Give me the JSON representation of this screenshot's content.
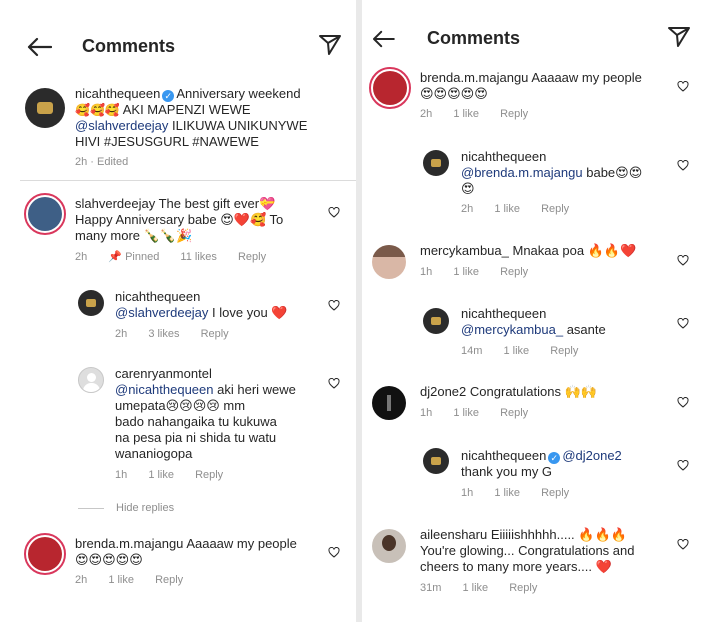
{
  "left": {
    "header": {
      "title": "Comments"
    },
    "caption": {
      "user": "nicahthequeen",
      "text_1": "Anniversary weekend",
      "text_2": "AKI MAPENZI WEWE",
      "mention": "@slahverdeejay",
      "text_3": "ILIKUWA UNIKUNYWE",
      "text_4": "HIVI #JESUSGURL #NAWEWE",
      "emoji_1": "🥰🥰🥰",
      "meta": "2h · Edited"
    },
    "comments": [
      {
        "user": "slahverdeejay",
        "text_1": "The best gift ever💝",
        "text_2": "Happy Anniversary babe 😍❤️🥰 To",
        "text_3": "many more 🍾🍾🎉",
        "time": "2h",
        "pinned": "Pinned",
        "likes": "11 likes",
        "reply": "Reply"
      },
      {
        "user": "nicahthequeen",
        "mention": "@slahverdeejay",
        "text_1": "I love you ❤️",
        "time": "2h",
        "likes": "3 likes",
        "reply": "Reply"
      },
      {
        "user": "carenryanmontel",
        "mention": "@nicahthequeen",
        "text_1": "aki heri wewe",
        "text_2": "umepata😢😢😢😢 mm",
        "text_3": "bado nahangaika tu kukuwa",
        "text_4": "na pesa pia ni shida tu watu",
        "text_5": "wananiogopa",
        "time": "1h",
        "likes": "1 like",
        "reply": "Reply"
      },
      {
        "user": "brenda.m.majangu",
        "text_1": "Aaaaaw my people",
        "text_2": "😍😍😍😍😍",
        "time": "2h",
        "likes": "1 like",
        "reply": "Reply"
      }
    ],
    "hide_replies": "Hide replies"
  },
  "right": {
    "header": {
      "title": "Comments"
    },
    "comments": [
      {
        "user": "brenda.m.majangu",
        "text_1": "Aaaaaw my people",
        "text_2": "😍😍😍😍😍",
        "time": "2h",
        "likes": "1 like",
        "reply": "Reply"
      },
      {
        "user": "nicahthequeen",
        "mention": "@brenda.m.majangu",
        "text_1": "babe😍😍",
        "text_2": "😍",
        "time": "2h",
        "likes": "1 like",
        "reply": "Reply"
      },
      {
        "user": "mercykambua_",
        "text_1": "Mnakaa poa 🔥🔥❤️",
        "time": "1h",
        "likes": "1 like",
        "reply": "Reply"
      },
      {
        "user": "nicahthequeen",
        "mention": "@mercykambua_",
        "text_1": "asante",
        "time": "14m",
        "likes": "1 like",
        "reply": "Reply"
      },
      {
        "user": "dj2one2",
        "text_1": "Congratulations 🙌🙌",
        "time": "1h",
        "likes": "1 like",
        "reply": "Reply"
      },
      {
        "user": "nicahthequeen",
        "mention": "@dj2one2",
        "text_1": "thank you my G",
        "time": "1h",
        "likes": "1 like",
        "reply": "Reply"
      },
      {
        "user": "aileensharu",
        "text_1": "Eiiiiishhhhh..... 🔥🔥🔥",
        "text_2": "You're glowing... Congratulations and",
        "text_3": "cheers to many more years.... ❤️",
        "time": "31m",
        "likes": "1 like",
        "reply": "Reply"
      }
    ]
  },
  "colors": {
    "mention": "#1e3a7b",
    "verified": "#3897f0",
    "meta": "#8e8e8e",
    "story_ring": "#d9375c"
  },
  "icons": [
    "back-arrow-icon",
    "send-icon",
    "heart-outline-icon",
    "pin-icon",
    "verified-badge-icon"
  ]
}
